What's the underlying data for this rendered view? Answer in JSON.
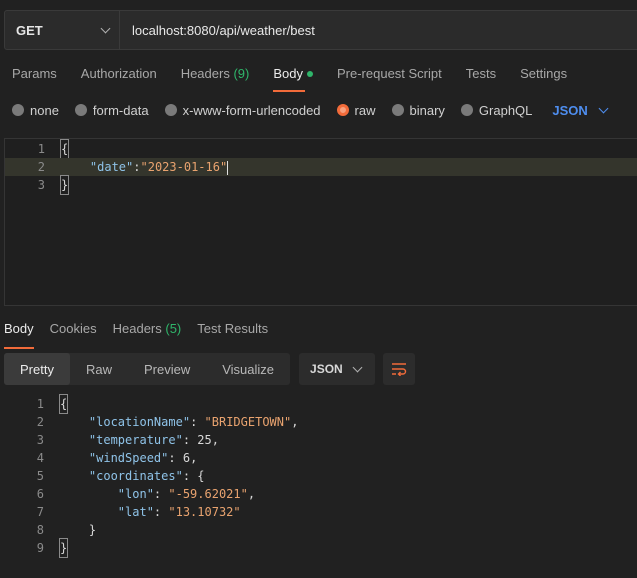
{
  "request": {
    "method": "GET",
    "url": "localhost:8080/api/weather/best"
  },
  "request_tabs": [
    {
      "label": "Params"
    },
    {
      "label": "Authorization"
    },
    {
      "label": "Headers",
      "count": "(9)"
    },
    {
      "label": "Body"
    },
    {
      "label": "Pre-request Script"
    },
    {
      "label": "Tests"
    },
    {
      "label": "Settings"
    }
  ],
  "body_types": [
    {
      "label": "none"
    },
    {
      "label": "form-data"
    },
    {
      "label": "x-www-form-urlencoded"
    },
    {
      "label": "raw"
    },
    {
      "label": "binary"
    },
    {
      "label": "GraphQL"
    }
  ],
  "body_format": "JSON",
  "request_body": {
    "line_numbers": [
      "1",
      "2",
      "3"
    ],
    "lines": [
      "{",
      "    \"date\":\"2023-01-16\"",
      "}"
    ],
    "key": "\"date\"",
    "value": "\"2023-01-16\""
  },
  "response_tabs": [
    {
      "label": "Body"
    },
    {
      "label": "Cookies"
    },
    {
      "label": "Headers",
      "count": "(5)"
    },
    {
      "label": "Test Results"
    }
  ],
  "view_modes": [
    "Pretty",
    "Raw",
    "Preview",
    "Visualize"
  ],
  "response_format": "JSON",
  "response_body": {
    "line_numbers": [
      "1",
      "2",
      "3",
      "4",
      "5",
      "6",
      "7",
      "8",
      "9"
    ],
    "open": "{",
    "close": "}",
    "locationName_key": "\"locationName\"",
    "locationName_val": "\"BRIDGETOWN\"",
    "temperature_key": "\"temperature\"",
    "temperature_val": "25",
    "windSpeed_key": "\"windSpeed\"",
    "windSpeed_val": "6",
    "coordinates_key": "\"coordinates\"",
    "lon_key": "\"lon\"",
    "lon_val": "\"-59.62021\"",
    "lat_key": "\"lat\"",
    "lat_val": "\"13.10732\"",
    "inner_close": "}"
  },
  "colors": {
    "accent": "#f26b3a",
    "count_green": "#2fb56a",
    "json_blue": "#4e8ef0"
  }
}
